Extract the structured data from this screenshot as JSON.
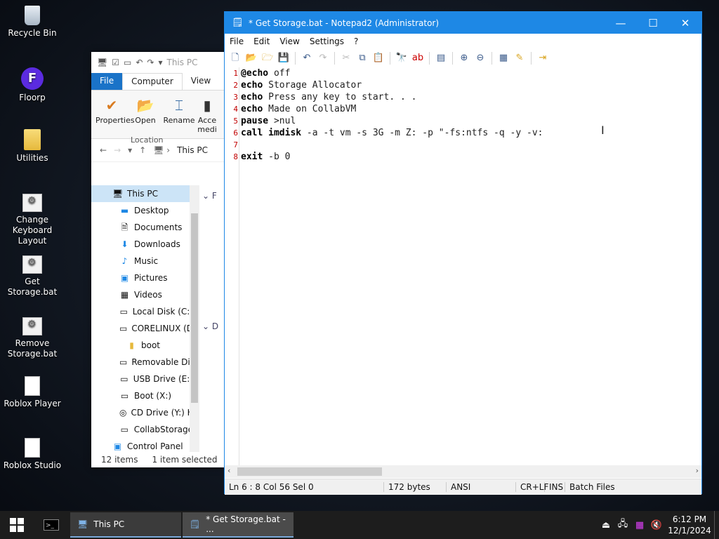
{
  "desktop": {
    "icons": [
      {
        "label": "Recycle Bin",
        "icon": "recycle-bin-icon"
      },
      {
        "label": "Floorp",
        "icon": "floorp-browser-icon"
      },
      {
        "label": "Utilities",
        "icon": "folder-icon"
      },
      {
        "label": "Change Keyboard Layout",
        "icon": "batch-file-icon"
      },
      {
        "label": "Get Storage.bat",
        "icon": "batch-file-icon"
      },
      {
        "label": "Remove Storage.bat",
        "icon": "batch-file-icon"
      },
      {
        "label": "Roblox Player",
        "icon": "blank-file-icon"
      },
      {
        "label": "Roblox Studio",
        "icon": "blank-file-icon"
      }
    ]
  },
  "explorer": {
    "title_fragment": "This PC",
    "tabs": {
      "file": "File",
      "computer": "Computer",
      "view": "View"
    },
    "ribbon": {
      "properties": "Properties",
      "open": "Open",
      "rename": "Rename",
      "access_media": "Acce medi",
      "group_label": "Location"
    },
    "address": {
      "crumb": "This PC"
    },
    "nav": [
      "This PC",
      "Desktop",
      "Documents",
      "Downloads",
      "Music",
      "Pictures",
      "Videos",
      "Local Disk (C:)",
      "CORELINUX (D",
      "boot",
      "Removable Dis",
      "USB Drive (E:)",
      "Boot (X:)",
      "CD Drive (Y:) H",
      "CollabStorage",
      "Control Panel"
    ],
    "right_fragments": [
      "F",
      "D"
    ],
    "status": {
      "items": "12 items",
      "selected": "1 item selected"
    }
  },
  "notepad": {
    "title": "* Get Storage.bat - Notepad2 (Administrator)",
    "menu": {
      "file": "File",
      "edit": "Edit",
      "view": "View",
      "settings": "Settings",
      "help": "?"
    },
    "lines": [
      {
        "n": "1",
        "kw": "@echo",
        "rest": " off"
      },
      {
        "n": "2",
        "kw": "echo",
        "rest": " Storage Allocator"
      },
      {
        "n": "3",
        "kw": "echo",
        "rest": " Press any key to start. . ."
      },
      {
        "n": "4",
        "kw": "echo",
        "rest": " Made on CollabVM"
      },
      {
        "n": "5",
        "kw": "pause",
        "rest": " >nul"
      },
      {
        "n": "6",
        "kw": "call imdisk",
        "rest": " -a -t vm -s 3G -m Z: -p \"-fs:ntfs -q -y -v:"
      },
      {
        "n": "7",
        "kw": "",
        "rest": ""
      },
      {
        "n": "8",
        "kw": "exit",
        "rest": " -b 0"
      }
    ],
    "status": {
      "position": "Ln 6 : 8    Col 56    Sel 0",
      "size": "172 bytes",
      "encoding": "ANSI",
      "eol": "CR+LF",
      "mode": "INS",
      "scheme": "Batch Files"
    }
  },
  "taskbar": {
    "tasks": [
      {
        "label": "This PC"
      },
      {
        "label": "* Get Storage.bat - ..."
      }
    ],
    "clock": {
      "time": "6:12 PM",
      "date": "12/1/2024"
    }
  }
}
